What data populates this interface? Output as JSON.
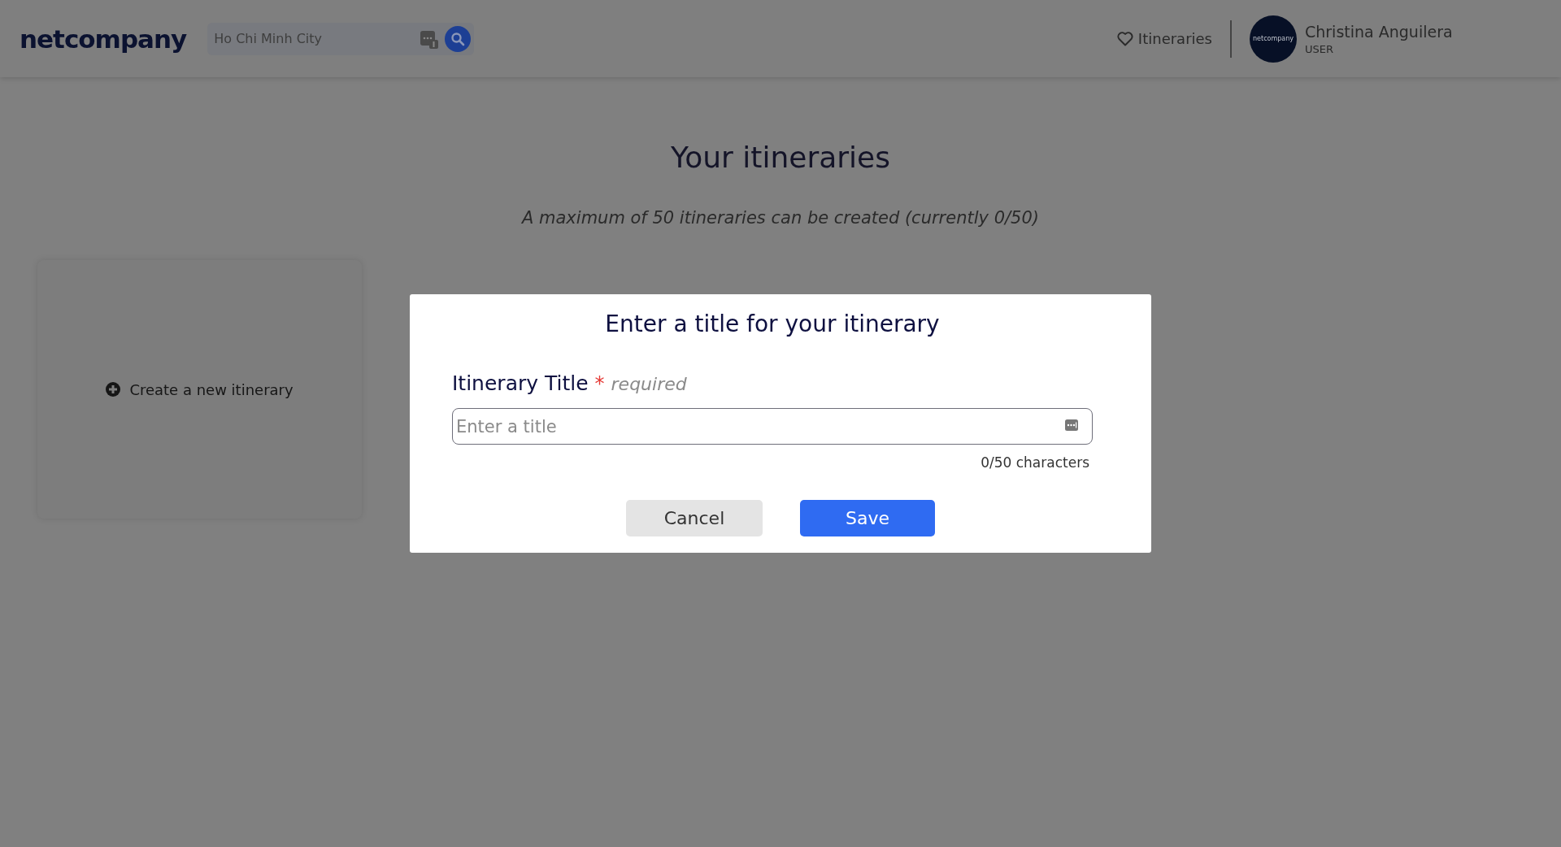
{
  "header": {
    "logo": "netcompany",
    "search": {
      "placeholder": "Ho Chi Minh City"
    },
    "nav_link": "Itineraries",
    "user": {
      "avatar_text": "netcompany",
      "name": "Christina Anguilera",
      "role": "USER"
    }
  },
  "page": {
    "title": "Your itineraries",
    "subtitle": "A maximum of 50 itineraries can be created (currently 0/50)",
    "create_card": "Create a new itinerary"
  },
  "dialog": {
    "title": "Enter a title for your itinerary",
    "field": {
      "label": "Itinerary Title",
      "required_mark": "*",
      "required_text": "required",
      "placeholder": "Enter a title",
      "counter": "0/50 characters"
    },
    "buttons": [
      {
        "label": "Cancel",
        "kind": "secondary"
      },
      {
        "label": "Save",
        "kind": "primary"
      }
    ]
  }
}
